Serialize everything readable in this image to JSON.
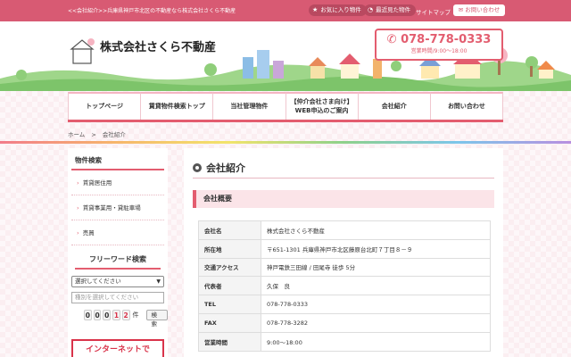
{
  "topbar": {
    "tagline": "<<会社紹介>>兵庫県神戸市北区の不動産なら株式会社さくら不動産",
    "favorites_label": "お気に入り物件",
    "recent_label": "最近見た物件",
    "sitemap_label": "サイトマップ",
    "contact_label": "お問い合わせ"
  },
  "header": {
    "company_name": "株式会社さくら不動産",
    "logo_text": "さくら不動産",
    "phone": "078-778-0333",
    "hours": "営業時間/9:00～18:00"
  },
  "nav": {
    "items": [
      {
        "label": "トップページ"
      },
      {
        "label": "賃貸物件検索トップ"
      },
      {
        "label": "当社管理物件"
      },
      {
        "label": "【仲介会社さま向け】WEB申込のご案内"
      },
      {
        "label": "会社紹介"
      },
      {
        "label": "お問い合わせ"
      }
    ]
  },
  "breadcrumb": {
    "home": "ホーム",
    "separator": ">",
    "current": "会社紹介"
  },
  "sidebar": {
    "section_title": "物件検索",
    "links": [
      {
        "label": "賃貸居住用"
      },
      {
        "label": "賃貸事業用・貸駐車場"
      },
      {
        "label": "売買"
      }
    ],
    "freeword_title": "フリーワード検索",
    "select_placeholder": "選択してください",
    "type_placeholder": "種別を選択してください",
    "counter_digits": [
      "0",
      "0",
      "0",
      "1",
      "2"
    ],
    "counter_unit": "件",
    "search_label": "検索",
    "banner_text": "インターネットで"
  },
  "main": {
    "page_title": "会社紹介",
    "section_title": "会社概要",
    "rows": [
      {
        "key": "会社名",
        "value": "株式会社さくら不動産"
      },
      {
        "key": "所在地",
        "value": "〒651-1301 兵庫県神戸市北区藤原台北町７丁目８－９"
      },
      {
        "key": "交通アクセス",
        "value": "神戸電鉄三田線 / 田尾寺 徒歩 5分"
      },
      {
        "key": "代表者",
        "value": "久保　良"
      },
      {
        "key": "TEL",
        "value": "078-778-0333"
      },
      {
        "key": "FAX",
        "value": "078-778-3282"
      },
      {
        "key": "営業時間",
        "value": "9:00～18:00"
      }
    ]
  },
  "colors": {
    "brand_pink": "#e35d6f",
    "top_strip": "#d85a73",
    "section_bg": "#fbe4e8"
  }
}
